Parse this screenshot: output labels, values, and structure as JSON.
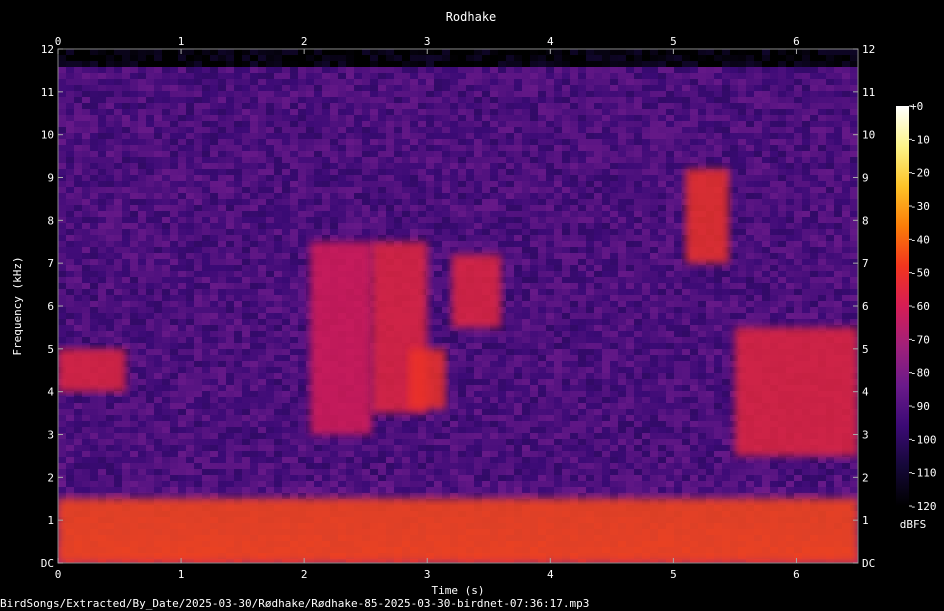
{
  "chart_data": {
    "type": "heatmap",
    "title": "Rodhake",
    "xlabel": "Time (s)",
    "ylabel": "Frequency (kHz)",
    "xlim": [
      0,
      6.5
    ],
    "ylim": [
      0,
      12
    ],
    "x_ticks": [
      "0",
      "1",
      "2",
      "3",
      "4",
      "5",
      "6"
    ],
    "y_ticks": [
      "DC",
      "1",
      "2",
      "3",
      "4",
      "5",
      "6",
      "7",
      "8",
      "9",
      "10",
      "11",
      "12"
    ],
    "colorbar": {
      "label": "dBFS",
      "range": [
        -120,
        0
      ],
      "ticks": [
        "+0",
        "-10",
        "-20",
        "-30",
        "-40",
        "-50",
        "-60",
        "-70",
        "-80",
        "-90",
        "-100",
        "-110",
        "-120"
      ],
      "colors": [
        "#000000",
        "#150838",
        "#3b0a75",
        "#6a1a8a",
        "#a0207a",
        "#d61d55",
        "#f2351e",
        "#fb7d08",
        "#fdc328",
        "#fcf48a",
        "#ffffff"
      ]
    },
    "energy_regions": [
      {
        "t": [
          0.0,
          6.5
        ],
        "f": [
          0.0,
          1.5
        ],
        "level_dbfs": -45
      },
      {
        "t": [
          0.0,
          0.55
        ],
        "f": [
          4.0,
          5.0
        ],
        "level_dbfs": -55
      },
      {
        "t": [
          2.05,
          2.55
        ],
        "f": [
          3.0,
          7.5
        ],
        "level_dbfs": -60
      },
      {
        "t": [
          2.55,
          3.0
        ],
        "f": [
          3.5,
          7.5
        ],
        "level_dbfs": -55
      },
      {
        "t": [
          2.85,
          3.15
        ],
        "f": [
          3.6,
          5.0
        ],
        "level_dbfs": -50
      },
      {
        "t": [
          3.2,
          3.6
        ],
        "f": [
          5.5,
          7.2
        ],
        "level_dbfs": -55
      },
      {
        "t": [
          5.1,
          5.45
        ],
        "f": [
          7.0,
          9.2
        ],
        "level_dbfs": -50
      },
      {
        "t": [
          5.5,
          6.5
        ],
        "f": [
          2.5,
          5.5
        ],
        "level_dbfs": -55
      }
    ]
  },
  "footer": {
    "path": "BirdSongs/Extracted/By_Date/2025-03-30/Rødhake/Rødhake-85-2025-03-30-birdnet-07:36:17.mp3"
  }
}
